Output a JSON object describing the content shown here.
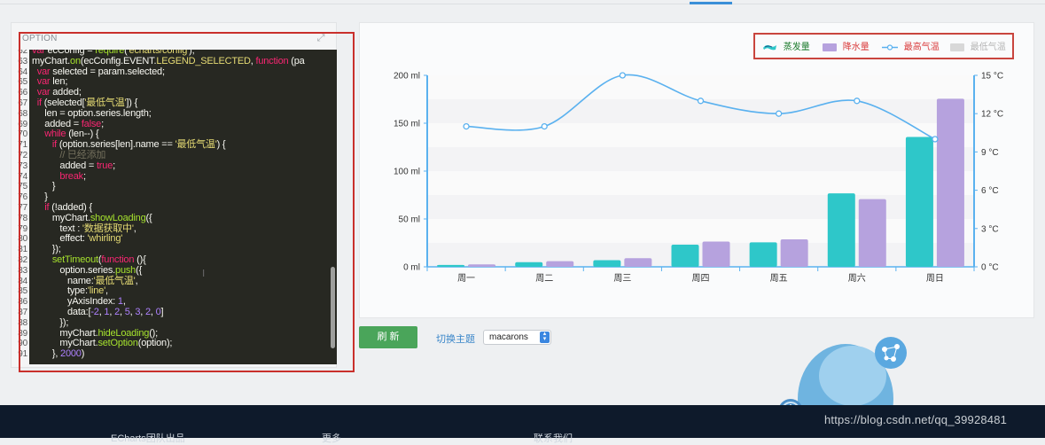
{
  "editor": {
    "label": "OPTION",
    "lines": [
      {
        "n": "62",
        "parts": [
          [
            "kw",
            "var "
          ],
          [
            "prop",
            "ecConfig = "
          ],
          [
            "fn",
            "require"
          ],
          [
            "prop",
            "("
          ],
          [
            "str",
            "'echarts/config'"
          ],
          [
            "prop",
            ");"
          ]
        ]
      },
      {
        "n": "63",
        "parts": [
          [
            "prop",
            "myChart."
          ],
          [
            "fn",
            "on"
          ],
          [
            "prop",
            "(ecConfig.EVENT."
          ],
          [
            "str",
            "LEGEND_SELECTED"
          ],
          [
            "prop",
            ", "
          ],
          [
            "kw",
            "function "
          ],
          [
            "prop",
            "(pa"
          ]
        ]
      },
      {
        "n": "64",
        "parts": [
          [
            "prop",
            "  "
          ],
          [
            "kw",
            "var "
          ],
          [
            "prop",
            "selected = param.selected;"
          ]
        ]
      },
      {
        "n": "65",
        "parts": [
          [
            "prop",
            "  "
          ],
          [
            "kw",
            "var "
          ],
          [
            "prop",
            "len;"
          ]
        ]
      },
      {
        "n": "66",
        "parts": [
          [
            "prop",
            "  "
          ],
          [
            "kw",
            "var "
          ],
          [
            "prop",
            "added;"
          ]
        ]
      },
      {
        "n": "67",
        "parts": [
          [
            "prop",
            "  "
          ],
          [
            "kw",
            "if "
          ],
          [
            "prop",
            "(selected["
          ],
          [
            "str",
            "'最低气温'"
          ],
          [
            "prop",
            "]) {"
          ]
        ]
      },
      {
        "n": "68",
        "parts": [
          [
            "prop",
            "     len = option.series.length;"
          ]
        ]
      },
      {
        "n": "69",
        "parts": [
          [
            "prop",
            "     added = "
          ],
          [
            "kw",
            "false"
          ],
          [
            "prop",
            ";"
          ]
        ]
      },
      {
        "n": "70",
        "parts": [
          [
            "prop",
            "     "
          ],
          [
            "kw",
            "while "
          ],
          [
            "prop",
            "(len--) {"
          ]
        ]
      },
      {
        "n": "71",
        "parts": [
          [
            "prop",
            "        "
          ],
          [
            "kw",
            "if "
          ],
          [
            "prop",
            "(option.series[len].name == "
          ],
          [
            "str",
            "'最低气温'"
          ],
          [
            "prop",
            ") {"
          ]
        ]
      },
      {
        "n": "72",
        "parts": [
          [
            "prop",
            "           "
          ],
          [
            "cm",
            "// 已经添加"
          ]
        ]
      },
      {
        "n": "73",
        "parts": [
          [
            "prop",
            "           added = "
          ],
          [
            "kw",
            "true"
          ],
          [
            "prop",
            ";"
          ]
        ]
      },
      {
        "n": "74",
        "parts": [
          [
            "prop",
            "           "
          ],
          [
            "kw",
            "break"
          ],
          [
            "prop",
            ";"
          ]
        ]
      },
      {
        "n": "75",
        "parts": [
          [
            "prop",
            "        }"
          ]
        ]
      },
      {
        "n": "76",
        "parts": [
          [
            "prop",
            "     }"
          ]
        ]
      },
      {
        "n": "77",
        "parts": [
          [
            "prop",
            "     "
          ],
          [
            "kw",
            "if "
          ],
          [
            "prop",
            "(!added) {"
          ]
        ]
      },
      {
        "n": "78",
        "parts": [
          [
            "prop",
            "        myChart."
          ],
          [
            "fn",
            "showLoading"
          ],
          [
            "prop",
            "({"
          ]
        ]
      },
      {
        "n": "79",
        "parts": [
          [
            "prop",
            "           text : "
          ],
          [
            "str",
            "'数据获取中'"
          ],
          [
            "prop",
            ","
          ]
        ]
      },
      {
        "n": "80",
        "parts": [
          [
            "prop",
            "           effect: "
          ],
          [
            "str",
            "'whirling'"
          ]
        ]
      },
      {
        "n": "81",
        "parts": [
          [
            "prop",
            "        });"
          ]
        ]
      },
      {
        "n": "82",
        "parts": [
          [
            "prop",
            "        "
          ],
          [
            "fn",
            "setTimeout"
          ],
          [
            "prop",
            "("
          ],
          [
            "kw",
            "function "
          ],
          [
            "prop",
            "(){"
          ]
        ]
      },
      {
        "n": "83",
        "parts": [
          [
            "prop",
            "           option.series."
          ],
          [
            "fn",
            "push"
          ],
          [
            "prop",
            "({"
          ]
        ]
      },
      {
        "n": "84",
        "parts": [
          [
            "prop",
            "              name:"
          ],
          [
            "str",
            "'最低气温'"
          ],
          [
            "prop",
            ","
          ]
        ]
      },
      {
        "n": "85",
        "parts": [
          [
            "prop",
            "              type:"
          ],
          [
            "str",
            "'line'"
          ],
          [
            "prop",
            ","
          ]
        ]
      },
      {
        "n": "86",
        "parts": [
          [
            "prop",
            "              yAxisIndex: "
          ],
          [
            "num",
            "1"
          ],
          [
            "prop",
            ","
          ]
        ]
      },
      {
        "n": "87",
        "parts": [
          [
            "prop",
            "              data:["
          ],
          [
            "num",
            "-2"
          ],
          [
            "prop",
            ", "
          ],
          [
            "num",
            "1"
          ],
          [
            "prop",
            ", "
          ],
          [
            "num",
            "2"
          ],
          [
            "prop",
            ", "
          ],
          [
            "num",
            "5"
          ],
          [
            "prop",
            ", "
          ],
          [
            "num",
            "3"
          ],
          [
            "prop",
            ", "
          ],
          [
            "num",
            "2"
          ],
          [
            "prop",
            ", "
          ],
          [
            "num",
            "0"
          ],
          [
            "prop",
            "]"
          ]
        ]
      },
      {
        "n": "88",
        "parts": [
          [
            "prop",
            "           });"
          ]
        ]
      },
      {
        "n": "89",
        "parts": [
          [
            "prop",
            "           myChart."
          ],
          [
            "fn",
            "hideLoading"
          ],
          [
            "prop",
            "();"
          ]
        ]
      },
      {
        "n": "90",
        "parts": [
          [
            "prop",
            "           myChart."
          ],
          [
            "fn",
            "setOption"
          ],
          [
            "prop",
            "(option);"
          ]
        ]
      },
      {
        "n": "91",
        "parts": [
          [
            "prop",
            "        }, "
          ],
          [
            "num",
            "2000"
          ],
          [
            "prop",
            ")"
          ]
        ]
      }
    ]
  },
  "legend": {
    "items": [
      {
        "name": "蒸发量",
        "color": "#2ec7c9",
        "text_color": "#1a7a2a",
        "kind": "icon"
      },
      {
        "name": "降水量",
        "color": "#b6a2de",
        "text_color": "#d93a3a",
        "kind": "bar"
      },
      {
        "name": "最高气温",
        "color": "#5ab1ef",
        "text_color": "#d93a3a",
        "kind": "line"
      },
      {
        "name": "最低气温",
        "color": "#d8d8d8",
        "text_color": "#b5b5b5",
        "kind": "bar"
      }
    ]
  },
  "chart_data": {
    "type": "bar",
    "categories": [
      "周一",
      "周二",
      "周三",
      "周四",
      "周五",
      "周六",
      "周日"
    ],
    "series": [
      {
        "name": "蒸发量",
        "type": "bar",
        "axis": "left",
        "values": [
          2.0,
          4.9,
          7.0,
          23.2,
          25.6,
          76.7,
          135.6
        ],
        "color": "#2ec7c9"
      },
      {
        "name": "降水量",
        "type": "bar",
        "axis": "left",
        "values": [
          2.6,
          5.9,
          9.0,
          26.4,
          28.7,
          70.7,
          175.6
        ],
        "color": "#b6a2de"
      },
      {
        "name": "最高气温",
        "type": "line",
        "axis": "right",
        "values": [
          11,
          11,
          15,
          13,
          12,
          13,
          10
        ],
        "color": "#5ab1ef"
      }
    ],
    "y_left": {
      "ticks": [
        "0 ml",
        "50 ml",
        "100 ml",
        "150 ml",
        "200 ml"
      ],
      "min": 0,
      "max": 200
    },
    "y_right": {
      "ticks": [
        "0 °C",
        "3 °C",
        "6 °C",
        "9 °C",
        "12 °C",
        "15 °C"
      ],
      "min": 0,
      "max": 15
    },
    "legend_position": "top-right"
  },
  "controls": {
    "refresh_label": "刷 新",
    "theme_label": "切换主题",
    "theme_value": "macarons"
  },
  "footer": {
    "col1": "ECharts团队出品",
    "col2": "更多",
    "col3": "联系我们",
    "watermark": "https://blog.csdn.net/qq_39928481"
  }
}
